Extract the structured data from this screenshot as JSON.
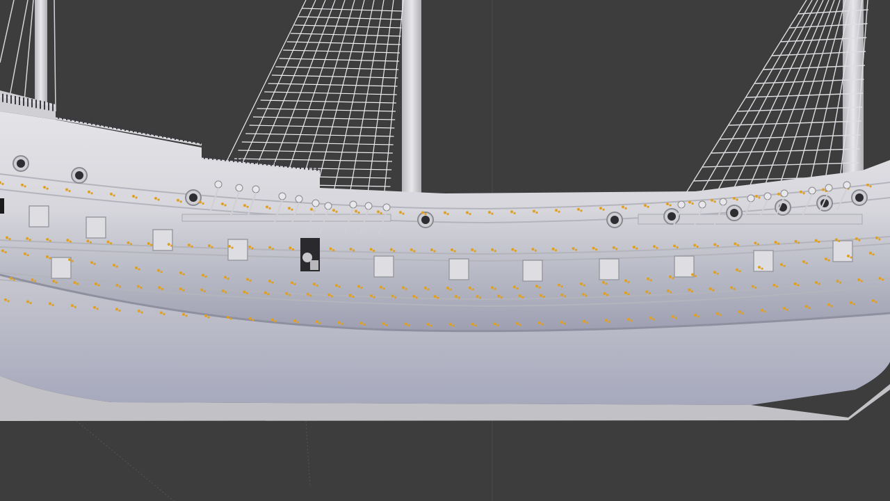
{
  "viewport": {
    "background": "#3d3d3d",
    "hull_color": "#dcdce0",
    "hull_shadow": "#9a9ca8",
    "rigging_color": "#e6e6ea",
    "mast_color": "#d8d8dc",
    "rivet_color": "#e0a020",
    "grid_line_color": "#555555"
  },
  "scene": {
    "object": "ship-model",
    "mode": "solid-shading"
  }
}
